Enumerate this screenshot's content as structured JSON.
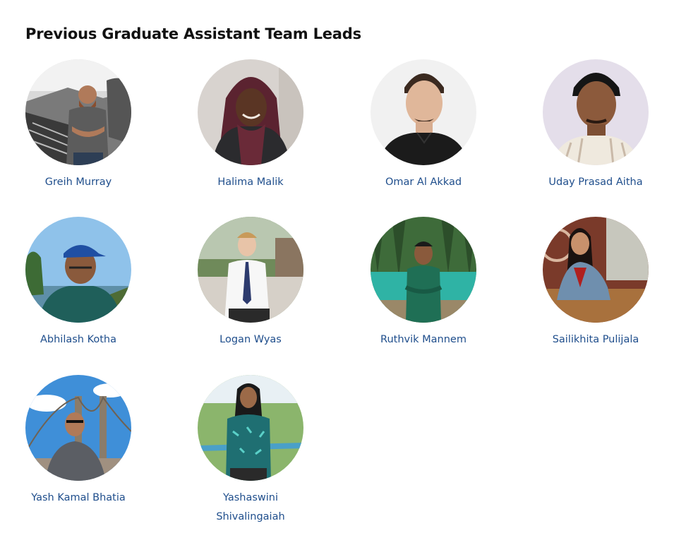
{
  "section": {
    "title": "Previous Graduate Assistant Team Leads"
  },
  "people": [
    {
      "name": "Greih Murray"
    },
    {
      "name": "Halima Malik"
    },
    {
      "name": "Omar Al Akkad"
    },
    {
      "name": "Uday Prasad Aitha"
    },
    {
      "name": "Abhilash Kotha"
    },
    {
      "name": "Logan Wyas"
    },
    {
      "name": "Ruthvik Mannem"
    },
    {
      "name": "Sailikhita Pulijala"
    },
    {
      "name": "Yash Kamal Bhatia"
    },
    {
      "name": "Yashaswini Shivalingaiah"
    }
  ],
  "colors": {
    "link": "#1f4e8c",
    "heading": "#111111"
  }
}
